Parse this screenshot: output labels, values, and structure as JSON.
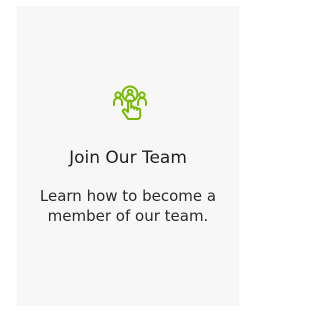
{
  "card": {
    "icon": "team-hand-pointer-icon",
    "title": "Join Our Team",
    "description": "Learn how to become a member of our team.",
    "accent_color": "#76b900",
    "background": "#f7f7f7"
  }
}
